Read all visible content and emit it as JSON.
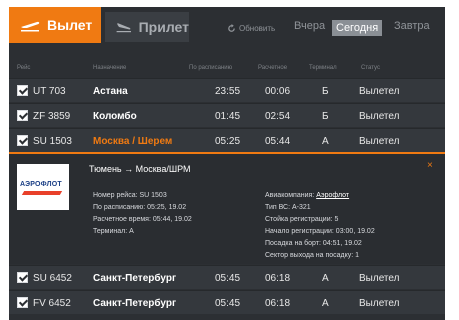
{
  "tabs": {
    "departures": "Вылет",
    "arrivals": "Прилет"
  },
  "refresh_label": "Обновить",
  "days": {
    "yesterday": "Вчера",
    "today": "Сегодня",
    "tomorrow": "Завтра"
  },
  "columns": {
    "flight": "Рейс",
    "destination": "Назначение",
    "scheduled": "По расписанию",
    "calculated": "Расчетное",
    "terminal": "Терминал",
    "status": "Статус"
  },
  "flights": [
    {
      "flight": "UT 703",
      "destination": "Астана",
      "scheduled": "23:55",
      "calculated": "00:06",
      "terminal": "Б",
      "status": "Вылетел"
    },
    {
      "flight": "ZF 3859",
      "destination": "Коломбо",
      "scheduled": "01:45",
      "calculated": "02:54",
      "terminal": "Б",
      "status": "Вылетел"
    },
    {
      "flight": "SU 1503",
      "destination": "Москва / Шерем",
      "scheduled": "05:25",
      "calculated": "05:44",
      "terminal": "А",
      "status": "Вылетел"
    },
    {
      "flight": "SU 6452",
      "destination": "Санкт-Петербург",
      "scheduled": "05:45",
      "calculated": "06:18",
      "terminal": "А",
      "status": "Вылетел"
    },
    {
      "flight": "FV 6452",
      "destination": "Санкт-Петербург",
      "scheduled": "05:45",
      "calculated": "06:18",
      "terminal": "А",
      "status": "Вылетел"
    }
  ],
  "detail": {
    "logo_text": "АЭРОФЛОТ",
    "route": "Тюмень → Москва/ШРМ",
    "close": "×",
    "flight_number": "Номер рейса: SU 1503",
    "scheduled": "По расписанию: 05:25, 19.02",
    "calculated": "Расчетное время: 05:44, 19.02",
    "terminal": "Терминал: А",
    "airline_label": "Авиакомпания:",
    "airline": "Аэрофлот",
    "aircraft": "Тип ВС: А-321",
    "checkin": "Стойка регистрации: 5",
    "checkin_start": "Начало регистрации: 03:00, 19.02",
    "boarding": "Посадка на борт: 04:51, 19.02",
    "gate": "Сектор выхода на посадку: 1"
  },
  "colors": {
    "accent": "#f07a12",
    "panel": "#2c2f33",
    "row": "#34383d"
  }
}
